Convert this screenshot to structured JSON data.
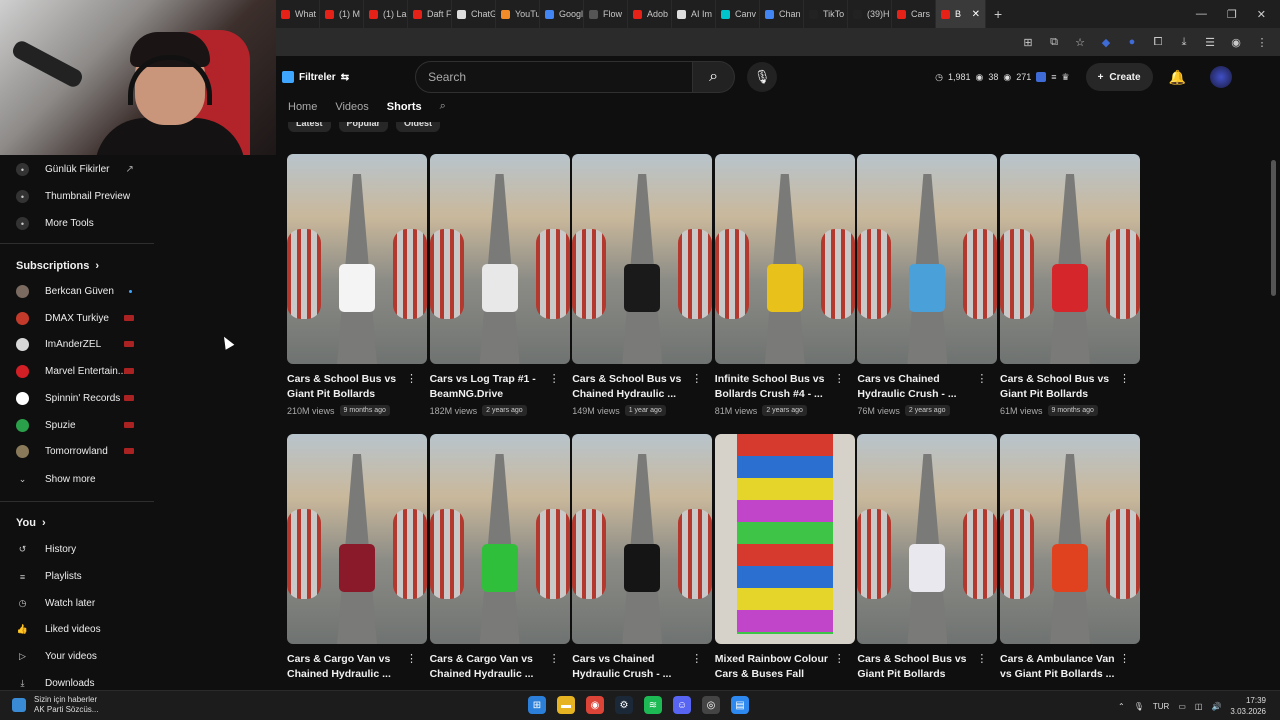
{
  "browser": {
    "tabs": [
      {
        "label": "What",
        "color": "#e62117"
      },
      {
        "label": "(1) M",
        "color": "#e62117"
      },
      {
        "label": "(1) La",
        "color": "#e62117"
      },
      {
        "label": "Daft F",
        "color": "#e62117"
      },
      {
        "label": "ChatG",
        "color": "#dddddd"
      },
      {
        "label": "YouTu",
        "color": "#f28c28"
      },
      {
        "label": "Googl",
        "color": "#4285f4"
      },
      {
        "label": "Flow",
        "color": "#555555"
      },
      {
        "label": "Adob",
        "color": "#e62117"
      },
      {
        "label": "AI Im",
        "color": "#dddddd"
      },
      {
        "label": "Canv",
        "color": "#00c4cc"
      },
      {
        "label": "Chan",
        "color": "#4285f4"
      },
      {
        "label": "TikTo",
        "color": "#222222"
      },
      {
        "label": "(39)H",
        "color": "#222222"
      },
      {
        "label": "Cars",
        "color": "#e62117"
      }
    ],
    "active_tab": {
      "label": "B",
      "color": "#e62117"
    }
  },
  "topbar": {
    "filter_label": "Filtreler",
    "search_placeholder": "Search",
    "stats": [
      "1,981",
      "38",
      "271"
    ],
    "create_label": "Create"
  },
  "channel_tabs": [
    "Home",
    "Videos",
    "Shorts"
  ],
  "sort_chips": [
    "Latest",
    "Popular",
    "Oldest"
  ],
  "sidebar": {
    "tools": [
      "Günlük Fikirler",
      "Thumbnail Preview",
      "More Tools"
    ],
    "subscriptions_heading": "Subscriptions",
    "subscriptions": [
      {
        "name": "Berkcan Güven",
        "avatar_color": "#7a6a60"
      },
      {
        "name": "DMAX Turkiye",
        "avatar_color": "#c43a2a"
      },
      {
        "name": "ImAnderZEL",
        "avatar_color": "#d8d8d8"
      },
      {
        "name": "Marvel Entertain...",
        "avatar_color": "#d21f26"
      },
      {
        "name": "Spinnin' Records",
        "avatar_color": "#ffffff"
      },
      {
        "name": "Spuzie",
        "avatar_color": "#2aa04a"
      },
      {
        "name": "Tomorrowland",
        "avatar_color": "#8a7a5a"
      }
    ],
    "show_more": "Show more",
    "you_heading": "You",
    "you_items": [
      "History",
      "Playlists",
      "Watch later",
      "Liked videos",
      "Your videos",
      "Downloads"
    ]
  },
  "shorts": [
    {
      "title": "Cars & School Bus vs Giant Pit Bollards Cras...",
      "views": "210M views",
      "age": "9 months ago",
      "vehicle_color": "#f4f4f4"
    },
    {
      "title": "Cars vs Log Trap #1 - BeamNG.Drive",
      "views": "182M views",
      "age": "2 years ago",
      "vehicle_color": "#e8e8e8"
    },
    {
      "title": "Cars & School Bus vs Chained Hydraulic ...",
      "views": "149M views",
      "age": "1 year ago",
      "vehicle_color": "#1a1a1a"
    },
    {
      "title": "Infinite School Bus vs Bollards Crush #4 - ...",
      "views": "81M views",
      "age": "2 years ago",
      "vehicle_color": "#e8c21a"
    },
    {
      "title": "Cars vs Chained Hydraulic Crush - ...",
      "views": "76M views",
      "age": "2 years ago",
      "vehicle_color": "#4aa0d8"
    },
    {
      "title": "Cars & School Bus vs Giant Pit Bollards Cras...",
      "views": "61M views",
      "age": "9 months ago",
      "vehicle_color": "#d4262b"
    },
    {
      "title": "Cars & Cargo Van vs Chained Hydraulic ...",
      "views": "",
      "age": "",
      "vehicle_color": "#8a1a2a"
    },
    {
      "title": "Cars & Cargo Van vs Chained Hydraulic ...",
      "views": "",
      "age": "",
      "vehicle_color": "#2fbf3a"
    },
    {
      "title": "Cars vs Chained Hydraulic Crush - ...",
      "views": "",
      "age": "",
      "vehicle_color": "#151515"
    },
    {
      "title": "Mixed Rainbow Colour Cars & Buses Fall Cras...",
      "views": "",
      "age": "",
      "vehicle_color": "#d63a2f"
    },
    {
      "title": "Cars & School Bus vs Giant Pit Bollards Cras...",
      "views": "",
      "age": "",
      "vehicle_color": "#e8e8ee"
    },
    {
      "title": "Cars & Ambulance Van vs Giant Pit Bollards ...",
      "views": "",
      "age": "",
      "vehicle_color": "#e0421f"
    }
  ],
  "taskbar": {
    "news_line1": "Sizin için haberler",
    "news_line2": "AK Parti Sözcüs...",
    "language": "TUR",
    "time": "17:39",
    "date": "3.03.2026"
  }
}
